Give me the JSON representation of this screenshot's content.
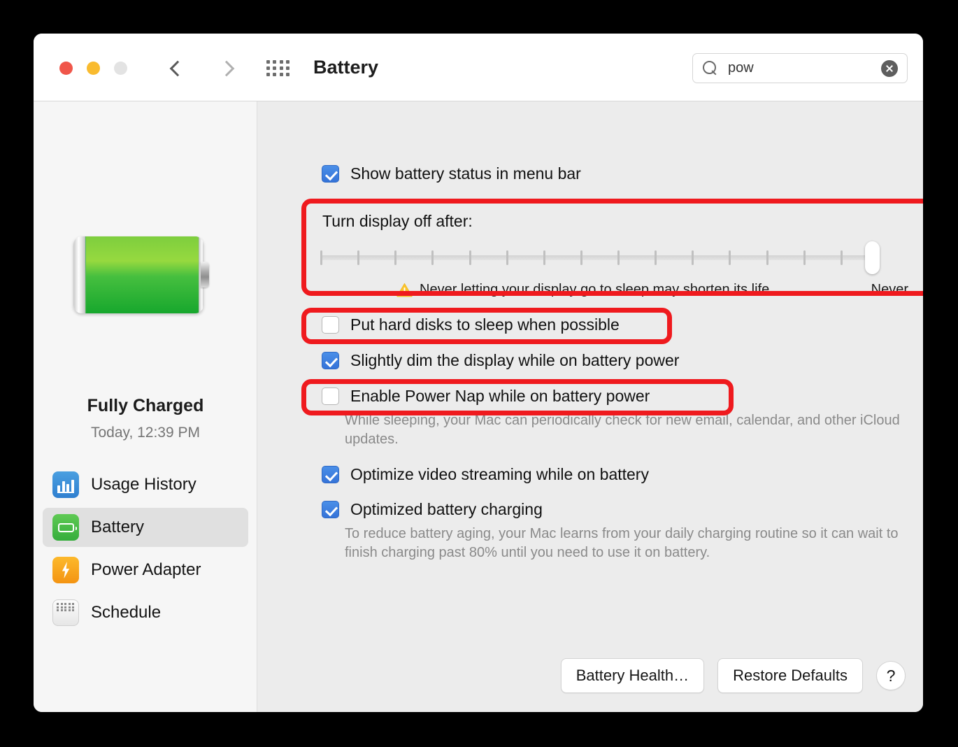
{
  "window": {
    "title": "Battery",
    "traffic_lights": [
      "close",
      "minimize",
      "zoom"
    ],
    "back_label": "Back",
    "forward_label": "Forward",
    "grid_label": "Show All"
  },
  "search": {
    "value": "pow",
    "placeholder": "Search",
    "icon": "search-icon",
    "clear_icon": "clear-icon"
  },
  "sidebar": {
    "battery_icon": "battery-full-icon",
    "status_title": "Fully Charged",
    "status_subtitle": "Today, 12:39 PM",
    "items": [
      {
        "label": "Usage History",
        "icon": "bar-chart-icon",
        "selected": false
      },
      {
        "label": "Battery",
        "icon": "battery-icon",
        "selected": true
      },
      {
        "label": "Power Adapter",
        "icon": "lightning-bolt-icon",
        "selected": false
      },
      {
        "label": "Schedule",
        "icon": "calendar-icon",
        "selected": false
      }
    ]
  },
  "main": {
    "show_battery_status": {
      "label": "Show battery status in menu bar",
      "checked": true
    },
    "display_off": {
      "label": "Turn display off after:",
      "slider": {
        "ticks": 16,
        "value_index": 16,
        "value_label": "Never",
        "max_label": "Never"
      },
      "warning_icon": "warning-triangle-icon",
      "warning_text": "Never letting your display go to sleep may shorten its life"
    },
    "hard_disks": {
      "label": "Put hard disks to sleep when possible",
      "checked": false
    },
    "dim_display": {
      "label": "Slightly dim the display while on battery power",
      "checked": true
    },
    "power_nap": {
      "label": "Enable Power Nap while on battery power",
      "checked": false,
      "help": "While sleeping, your Mac can periodically check for new email, calendar, and other iCloud updates."
    },
    "optimize_video": {
      "label": "Optimize video streaming while on battery",
      "checked": true
    },
    "optimized_charging": {
      "label": "Optimized battery charging",
      "checked": true,
      "help": "To reduce battery aging, your Mac learns from your daily charging routine so it can wait to finish charging past 80% until you need to use it on battery."
    }
  },
  "footer": {
    "battery_health": "Battery Health…",
    "restore_defaults": "Restore Defaults",
    "help": "?"
  },
  "annotations": {
    "color": "#ef1a1e",
    "boxes": [
      "turn-display-off-after",
      "put-hard-disks-to-sleep",
      "enable-power-nap"
    ]
  }
}
